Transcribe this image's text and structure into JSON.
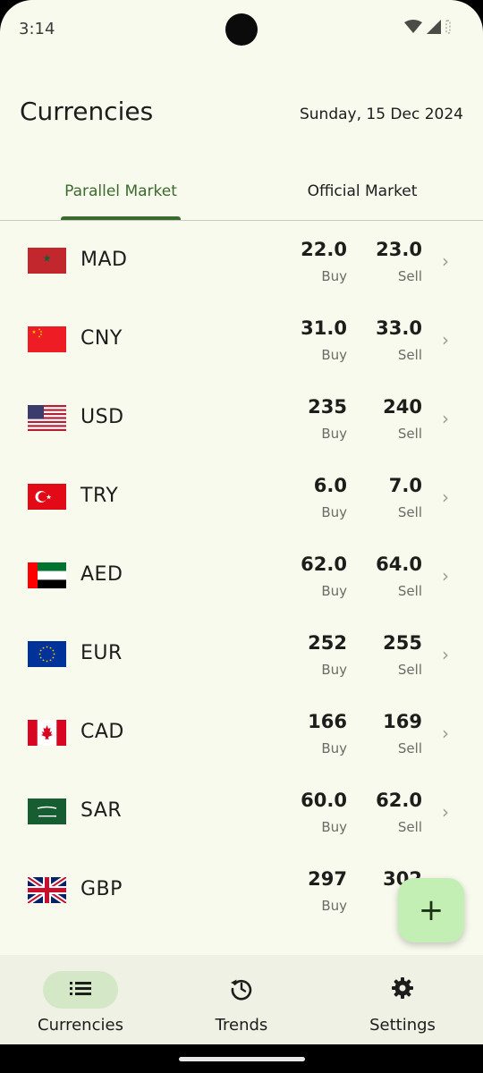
{
  "status_bar": {
    "time": "3:14"
  },
  "header": {
    "title": "Currencies",
    "date": "Sunday, 15 Dec 2024"
  },
  "tabs": [
    {
      "label": "Parallel Market",
      "selected": true
    },
    {
      "label": "Official Market",
      "selected": false
    }
  ],
  "rate_labels": {
    "buy": "Buy",
    "sell": "Sell"
  },
  "currencies": [
    {
      "code": "MAD",
      "flag": "morocco-flag",
      "buy": "22.0",
      "sell": "23.0"
    },
    {
      "code": "CNY",
      "flag": "china-flag",
      "buy": "31.0",
      "sell": "33.0"
    },
    {
      "code": "USD",
      "flag": "usa-flag",
      "buy": "235",
      "sell": "240"
    },
    {
      "code": "TRY",
      "flag": "turkey-flag",
      "buy": "6.0",
      "sell": "7.0"
    },
    {
      "code": "AED",
      "flag": "uae-flag",
      "buy": "62.0",
      "sell": "64.0"
    },
    {
      "code": "EUR",
      "flag": "eu-flag",
      "buy": "252",
      "sell": "255"
    },
    {
      "code": "CAD",
      "flag": "canada-flag",
      "buy": "166",
      "sell": "169"
    },
    {
      "code": "SAR",
      "flag": "saudi-flag",
      "buy": "60.0",
      "sell": "62.0"
    },
    {
      "code": "GBP",
      "flag": "uk-flag",
      "buy": "297",
      "sell": "302"
    }
  ],
  "fab": {
    "icon": "plus-icon",
    "label": "+"
  },
  "bottom_nav": [
    {
      "label": "Currencies",
      "icon": "list-icon",
      "active": true
    },
    {
      "label": "Trends",
      "icon": "history-icon",
      "active": false
    },
    {
      "label": "Settings",
      "icon": "gear-icon",
      "active": false
    }
  ],
  "colors": {
    "background": "#f8faee",
    "accent": "#3b6a2d",
    "fab": "#c3eeb4",
    "nav_active": "#d4e8c8"
  }
}
